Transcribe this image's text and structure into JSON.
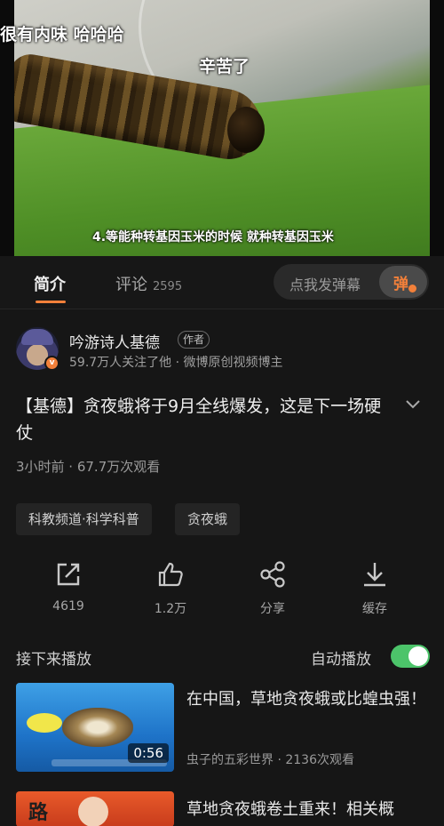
{
  "video": {
    "subtitle_left": "很有内味 哈哈哈",
    "subtitle_mid": "辛苦了",
    "subtitle_bottom": "4.等能种转基因玉米的时候 就种转基因玉米"
  },
  "tabs": {
    "intro": "简介",
    "comments": "评论",
    "comment_count": "2595",
    "danmaku_placeholder": "点我发弹幕",
    "danmaku_button": "弹"
  },
  "author": {
    "name": "吟游诗人基德",
    "badge": "作者",
    "meta": "59.7万人关注了他 · 微博原创视频博主",
    "verify_mark": "v"
  },
  "post": {
    "title": "【基德】贪夜蛾将于9月全线爆发，这是下一场硬仗",
    "stats": "3小时前 · 67.7万次观看"
  },
  "tags": [
    "科教频道·科学科普",
    "贪夜蛾"
  ],
  "actions": [
    {
      "icon": "share-out-icon",
      "label": "4619"
    },
    {
      "icon": "thumbs-up-icon",
      "label": "1.2万"
    },
    {
      "icon": "share-icon",
      "label": "分享"
    },
    {
      "icon": "download-icon",
      "label": "缓存"
    }
  ],
  "upnext": {
    "title": "接下来播放",
    "autoplay_label": "自动播放",
    "autoplay_on": true
  },
  "recommendations": [
    {
      "title": "在中国，草地贪夜蛾或比蝗虫强！",
      "meta": "虫子的五彩世界 · 2136次观看",
      "duration": "0:56"
    },
    {
      "title": "草地贪夜蛾卷土重来！相关概",
      "thumb_text": "路 强"
    }
  ],
  "colors": {
    "accent": "#f2803a",
    "toggle_on": "#4cc46a",
    "background": "#161616"
  }
}
